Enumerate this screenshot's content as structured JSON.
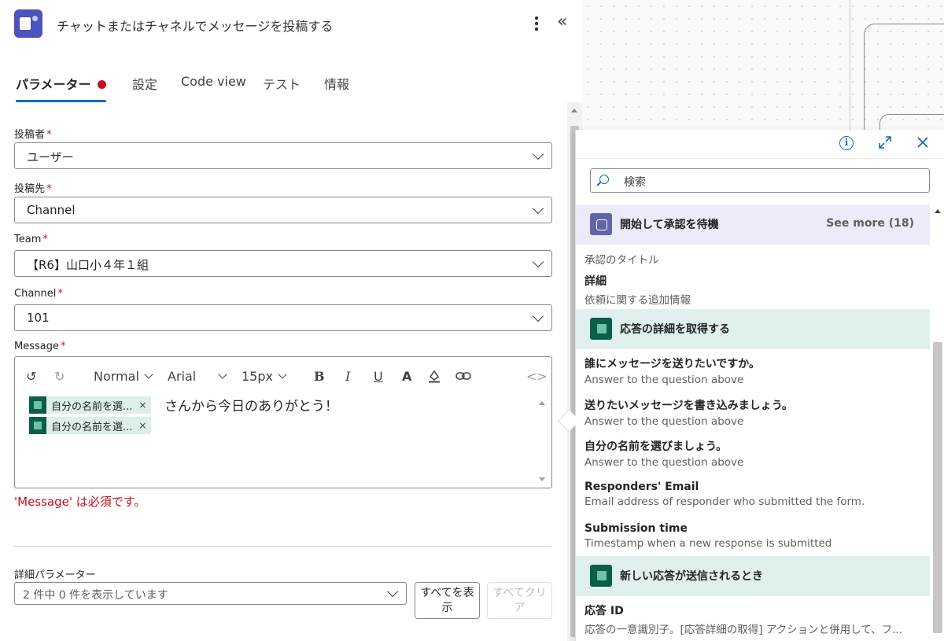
{
  "header": {
    "title": "チャットまたはチャネルでメッセージを投稿する"
  },
  "tabs": [
    {
      "label": "パラメーター",
      "active": true,
      "has_error": true
    },
    {
      "label": "設定"
    },
    {
      "label": "Code view"
    },
    {
      "label": "テスト"
    },
    {
      "label": "情報"
    }
  ],
  "form": {
    "poster": {
      "label": "投稿者",
      "value": "ユーザー"
    },
    "post_in": {
      "label": "投稿先",
      "value": "Channel"
    },
    "team": {
      "label": "Team",
      "value": "【R6】山口小４年１組"
    },
    "channel": {
      "label": "Channel",
      "value": "101"
    },
    "message": {
      "label": "Message",
      "toolbar": {
        "paragraph": "Normal",
        "font": "Arial",
        "size": "15px"
      },
      "tokens": [
        "自分の名前を選...",
        "自分の名前を選..."
      ],
      "text_after_first_token": "さんから今日のありがとう！",
      "error": "'Message' は必須です。"
    },
    "required_mark": "*"
  },
  "advanced": {
    "label": "詳細パラメーター",
    "select_value": "2 件中 0 件を表示しています",
    "show_all": "すべてを表示",
    "clear_all": "すべてクリア"
  },
  "flyout": {
    "search_placeholder": "検索",
    "sections": [
      {
        "title": "開始して承認を待機",
        "see_more": "See more (18)",
        "items": [
          {
            "title": "",
            "desc": "承認のタイトル"
          },
          {
            "title": "詳細",
            "desc": "依頼に関する追加情報"
          }
        ]
      },
      {
        "title": "応答の詳細を取得する",
        "items": [
          {
            "title": "誰にメッセージを送りたいですか。",
            "desc": "Answer to the question above"
          },
          {
            "title": "送りたいメッセージを書き込みましょう。",
            "desc": "Answer to the question above"
          },
          {
            "title": "自分の名前を選びましょう。",
            "desc": "Answer to the question above"
          },
          {
            "title": "Responders' Email",
            "desc": "Email address of responder who submitted the form."
          },
          {
            "title": "Submission time",
            "desc": "Timestamp when a new response is submitted"
          }
        ]
      },
      {
        "title": "新しい応答が送信されるとき",
        "items": [
          {
            "title": "応答 ID",
            "desc": "応答の一意識別子。[応答詳細の取得] アクションと併用して、フ..."
          }
        ]
      }
    ]
  },
  "colors": {
    "accent": "#0f6cbd",
    "error": "#c50f1f",
    "teams_brand": "#4b53bc",
    "approval_section_bg": "#ebebfa",
    "forms_section_bg": "#e0f0ef"
  }
}
